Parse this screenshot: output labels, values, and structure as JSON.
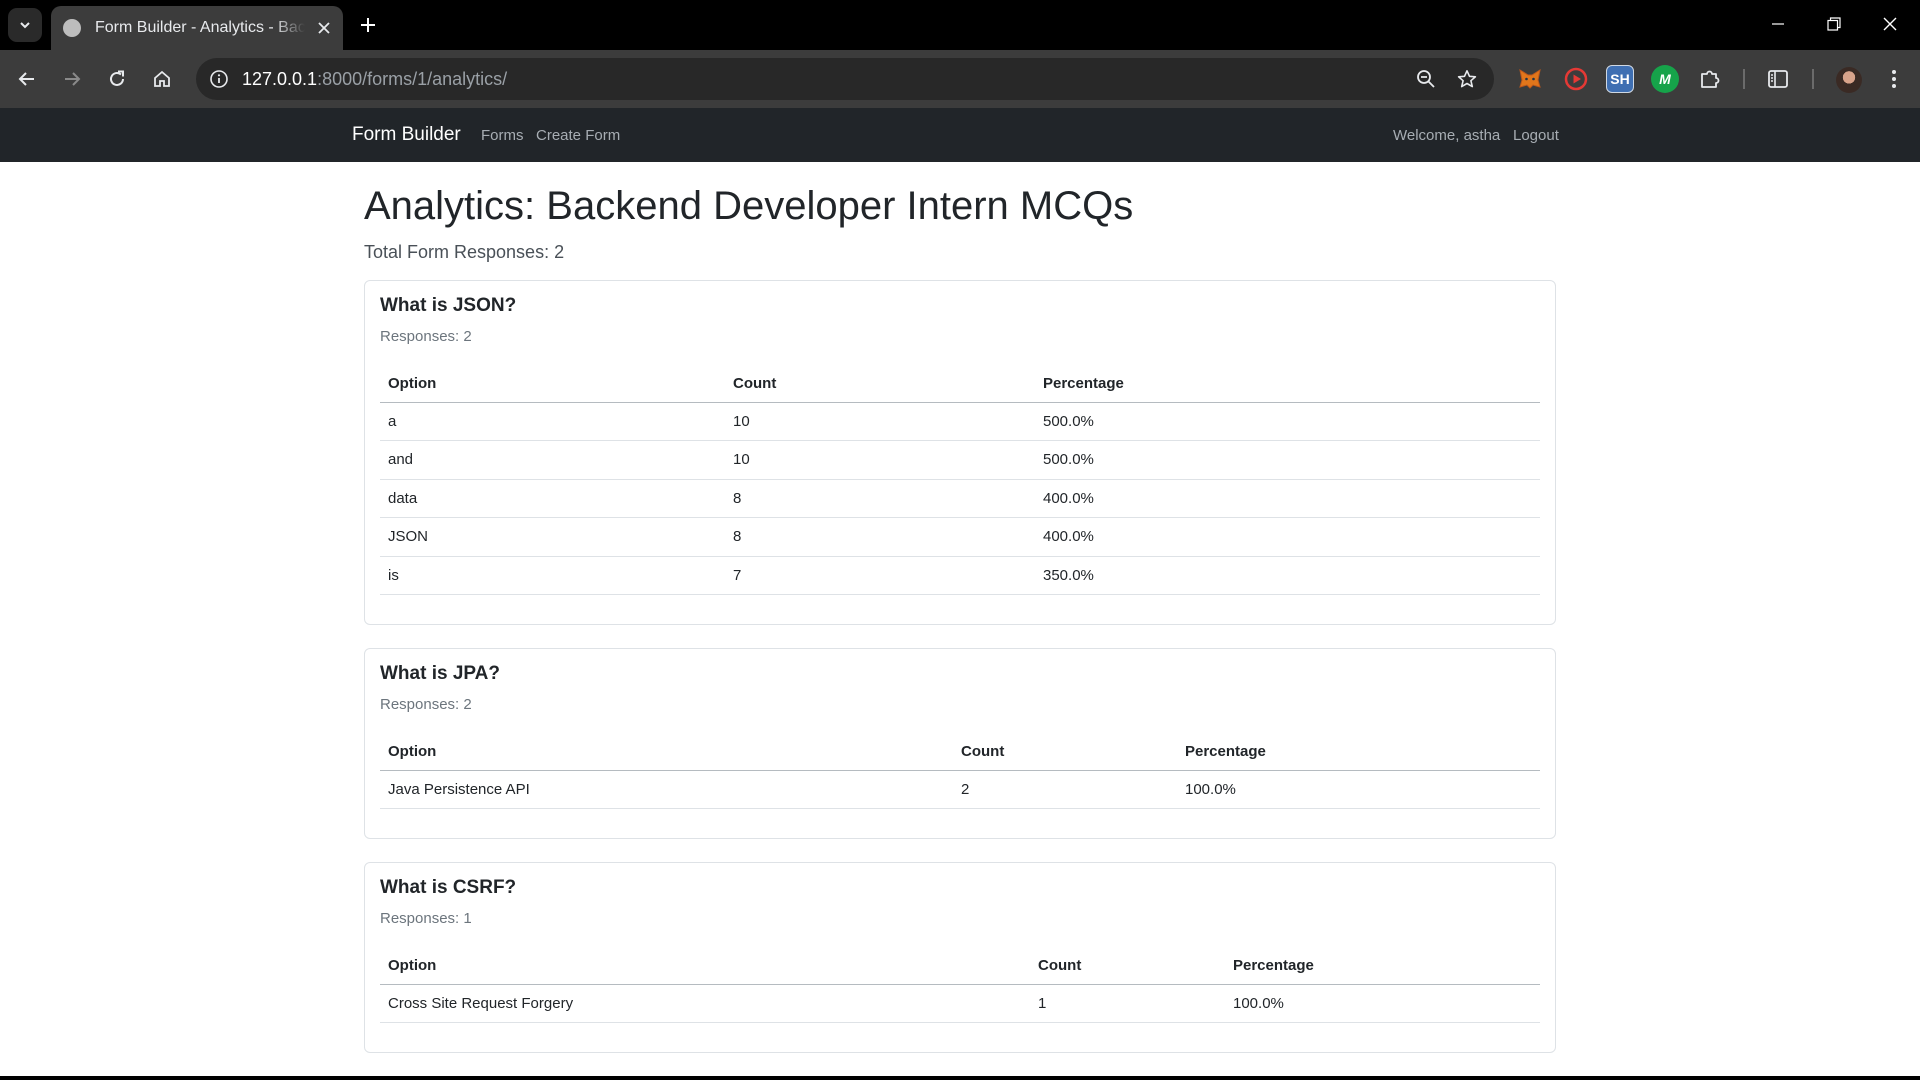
{
  "browser": {
    "tab_title": "Form Builder - Analytics - Backend Developer Intern MCQs",
    "url_host": "127.0.0.1",
    "url_rest": ":8000/forms/1/analytics/"
  },
  "navbar": {
    "brand": "Form Builder",
    "links": [
      "Forms",
      "Create Form"
    ],
    "welcome": "Welcome, astha",
    "logout": "Logout"
  },
  "page": {
    "title": "Analytics: Backend Developer Intern MCQs",
    "total": "Total Form Responses: 2"
  },
  "questions": [
    {
      "title": "What is JSON?",
      "responses": "Responses: 2",
      "headers": [
        "Option",
        "Count",
        "Percentage"
      ],
      "rows": [
        [
          "a",
          "10",
          "500.0%"
        ],
        [
          "and",
          "10",
          "500.0%"
        ],
        [
          "data",
          "8",
          "400.0%"
        ],
        [
          "JSON",
          "8",
          "400.0%"
        ],
        [
          "is",
          "7",
          "350.0%"
        ]
      ]
    },
    {
      "title": "What is JPA?",
      "responses": "Responses: 2",
      "headers": [
        "Option",
        "Count",
        "Percentage"
      ],
      "rows": [
        [
          "Java Persistence API",
          "2",
          "100.0%"
        ]
      ]
    },
    {
      "title": "What is CSRF?",
      "responses": "Responses: 1",
      "headers": [
        "Option",
        "Count",
        "Percentage"
      ],
      "rows": [
        [
          "Cross Site Request Forgery",
          "1",
          "100.0%"
        ]
      ]
    }
  ],
  "icons": {
    "tab_search": "chevron-down-icon",
    "favicon": "globe-icon",
    "tab_close": "close-icon",
    "new_tab": "plus-icon",
    "back": "arrow-left-icon",
    "forward": "arrow-right-icon",
    "reload": "reload-icon",
    "home": "home-icon",
    "site_info": "info-icon",
    "zoom": "zoom-icon",
    "bookmark": "star-icon",
    "extensions": [
      "metamask-icon",
      "record-icon",
      "sh-icon",
      "m-icon",
      "puzzle-icon"
    ],
    "side_panel": "side-panel-icon",
    "menu": "kebab-menu-icon"
  },
  "extension_labels": {
    "sh": "SH",
    "m": "M"
  },
  "colors": {
    "navbar_bg": "#212529",
    "chrome_bg": "#3c3c3c",
    "tab_strip_bg": "#000000"
  }
}
